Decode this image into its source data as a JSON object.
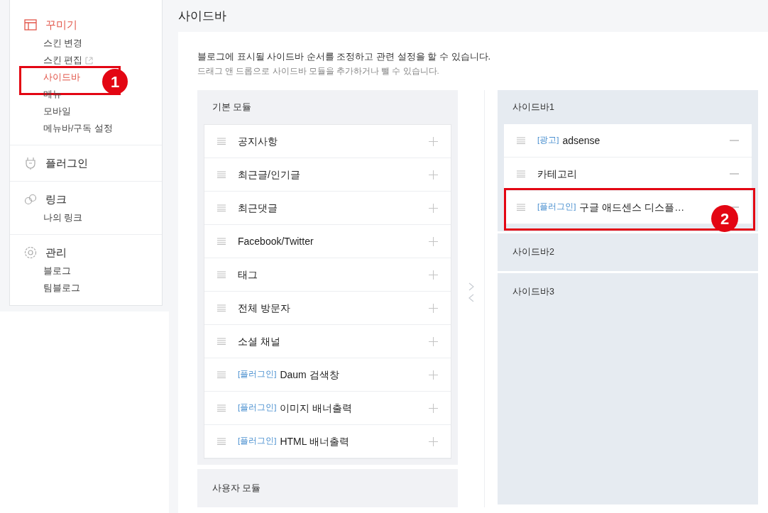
{
  "nav": [
    {
      "kind": "layout",
      "title": "꾸미기",
      "selected": true,
      "items": [
        {
          "label": "스킨 변경",
          "selected": false
        },
        {
          "label": "스킨 편집",
          "selected": false,
          "external": true
        },
        {
          "label": "사이드바",
          "selected": true
        },
        {
          "label": "메뉴",
          "selected": false
        },
        {
          "label": "모바일",
          "selected": false
        },
        {
          "label": "메뉴바/구독 설정",
          "selected": false
        }
      ]
    },
    {
      "kind": "plug",
      "title": "플러그인",
      "selected": false
    },
    {
      "kind": "link",
      "title": "링크",
      "selected": false,
      "items": [
        {
          "label": "나의 링크",
          "selected": false
        }
      ]
    },
    {
      "kind": "gear",
      "title": "관리",
      "selected": false,
      "items": [
        {
          "label": "블로그",
          "selected": false
        },
        {
          "label": "팀블로그",
          "selected": false
        }
      ]
    }
  ],
  "page_title": "사이드바",
  "description": [
    "블로그에 표시될 사이드바 순서를 조정하고 관련 설정을 할 수 있습니다.",
    "드래그 앤 드롭으로 사이드바 모듈을 추가하거나 뺄 수 있습니다."
  ],
  "basic_modules": {
    "title": "기본 모듈",
    "items": [
      {
        "name": "공지사항"
      },
      {
        "name": "최근글/인기글"
      },
      {
        "name": "최근댓글"
      },
      {
        "name": "Facebook/Twitter"
      },
      {
        "name": "태그"
      },
      {
        "name": "전체 방문자"
      },
      {
        "name": "소셜 채널"
      },
      {
        "tag": "[플러그인]",
        "name": "Daum 검색창"
      },
      {
        "tag": "[플러그인]",
        "name": "이미지 배너출력"
      },
      {
        "tag": "[플러그인]",
        "name": "HTML 배너출력"
      }
    ]
  },
  "user_modules": {
    "title": "사용자 모듈"
  },
  "sidebars": [
    {
      "title": "사이드바1",
      "items": [
        {
          "tag": "[광고]",
          "name": "adsense"
        },
        {
          "name": "카테고리"
        },
        {
          "tag": "[플러그인]",
          "name": "구글 애드센스 디스플…",
          "annotation": "2"
        }
      ]
    },
    {
      "title": "사이드바2"
    },
    {
      "title": "사이드바3"
    }
  ],
  "annotations": [
    {
      "label": "1"
    }
  ]
}
